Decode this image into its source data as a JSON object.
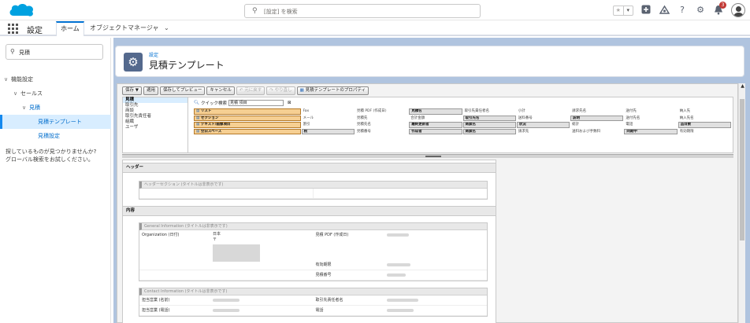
{
  "topbar": {
    "search_placeholder": "[設定] を検索",
    "notification_count": "3",
    "icons": [
      "favorites-star-icon",
      "favorites-dropdown-icon",
      "add-icon",
      "trailhead-icon",
      "help-icon",
      "gear-icon",
      "bell-icon",
      "avatar"
    ]
  },
  "navbar": {
    "app_name": "設定",
    "tabs": [
      {
        "label": "ホーム",
        "active": true
      },
      {
        "label": "オブジェクトマネージャ",
        "active": false
      }
    ]
  },
  "sidebar": {
    "quick_find_value": "見積",
    "tree": [
      {
        "label": "機能設定",
        "level": 0,
        "expanded": true
      },
      {
        "label": "セールス",
        "level": 1,
        "expanded": true
      },
      {
        "label": "見積",
        "level": 2,
        "expanded": true
      },
      {
        "label": "見積テンプレート",
        "level": 3,
        "selected": true
      },
      {
        "label": "見積設定",
        "level": 3,
        "selected": false
      }
    ],
    "hint_line1": "探しているものが見つかりませんか?",
    "hint_line2": "グローバル検索をお試しください。"
  },
  "page": {
    "breadcrumb": "設定",
    "title": "見積テンプレート"
  },
  "editor": {
    "toolbar": [
      {
        "label": "保存 ▼",
        "enabled": true
      },
      {
        "label": "適用",
        "enabled": true
      },
      {
        "label": "保存してプレビュー",
        "enabled": true
      },
      {
        "label": "キャンセル",
        "enabled": true
      },
      {
        "label": "元に戻す",
        "enabled": false
      },
      {
        "label": "やり直し",
        "enabled": false
      },
      {
        "label": "見積テンプレートのプロパティ",
        "enabled": true
      }
    ],
    "palette_categories": [
      "見積",
      "取引先",
      "商談",
      "取引先責任者",
      "組織",
      "ユーザ"
    ],
    "quick_search_label": "クイック検索",
    "quick_search_value": "見積 項目",
    "field_rows": [
      [
        {
          "t": "リスト",
          "s": "o"
        },
        {
          "t": "Fax",
          "s": ""
        },
        {
          "t": "見積 PDF (作成日)",
          "s": ""
        },
        {
          "t": "見積名",
          "s": "b"
        },
        {
          "t": "取引先責任者名",
          "s": ""
        },
        {
          "t": "小計",
          "s": ""
        },
        {
          "t": "請求先名",
          "s": ""
        },
        {
          "t": "送付先",
          "s": ""
        },
        {
          "t": "納入先",
          "s": ""
        }
      ],
      [
        {
          "t": "セクション",
          "s": "o"
        },
        {
          "t": "メール",
          "s": ""
        },
        {
          "t": "見積先",
          "s": ""
        },
        {
          "t": "合計金額",
          "s": ""
        },
        {
          "t": "取引先名",
          "s": "b"
        },
        {
          "t": "送料番号",
          "s": ""
        },
        {
          "t": "説明",
          "s": "b"
        },
        {
          "t": "送付先名",
          "s": ""
        },
        {
          "t": "納入先名",
          "s": ""
        }
      ],
      [
        {
          "t": "テキスト/画像項目",
          "s": "o"
        },
        {
          "t": "割引",
          "s": ""
        },
        {
          "t": "見積先名",
          "s": ""
        },
        {
          "t": "最終更新者",
          "s": "b"
        },
        {
          "t": "商談名",
          "s": "b"
        },
        {
          "t": "状況",
          "s": "b"
        },
        {
          "t": "総計",
          "s": ""
        },
        {
          "t": "電話",
          "s": ""
        },
        {
          "t": "品目数",
          "s": "b"
        }
      ],
      [
        {
          "t": "空白スペース",
          "s": "o"
        },
        {
          "t": "税",
          "s": "b"
        },
        {
          "t": "見積番号",
          "s": ""
        },
        {
          "t": "作成者",
          "s": "b"
        },
        {
          "t": "商談名",
          "s": "b"
        },
        {
          "t": "請求先",
          "s": ""
        },
        {
          "t": "送料および手数料",
          "s": ""
        },
        {
          "t": "同期中",
          "s": "b"
        },
        {
          "t": "有効期限",
          "s": ""
        }
      ]
    ],
    "header_section_label": "ヘッダー",
    "header_subsection": "ヘッダーセクション (タイトルは非表示です)",
    "content_section_label": "内容",
    "general_info_title": "General Information (タイトルは非表示です)",
    "org_label": "Organization (日付)",
    "org_value_line1": "日本",
    "org_value_line2": "〒",
    "quote_pdf_label": "見積 PDF (作成日)",
    "expiry_label": "有効期限",
    "quote_number_label": "見積番号",
    "contact_info_title": "Contact Information (タイトルは非表示です)",
    "owner_name_label": "担当営業 (名前)",
    "contact_name_label": "取引先責任者名",
    "owner_phone_label": "担当営業 (電話)",
    "phone_label": "電話"
  }
}
